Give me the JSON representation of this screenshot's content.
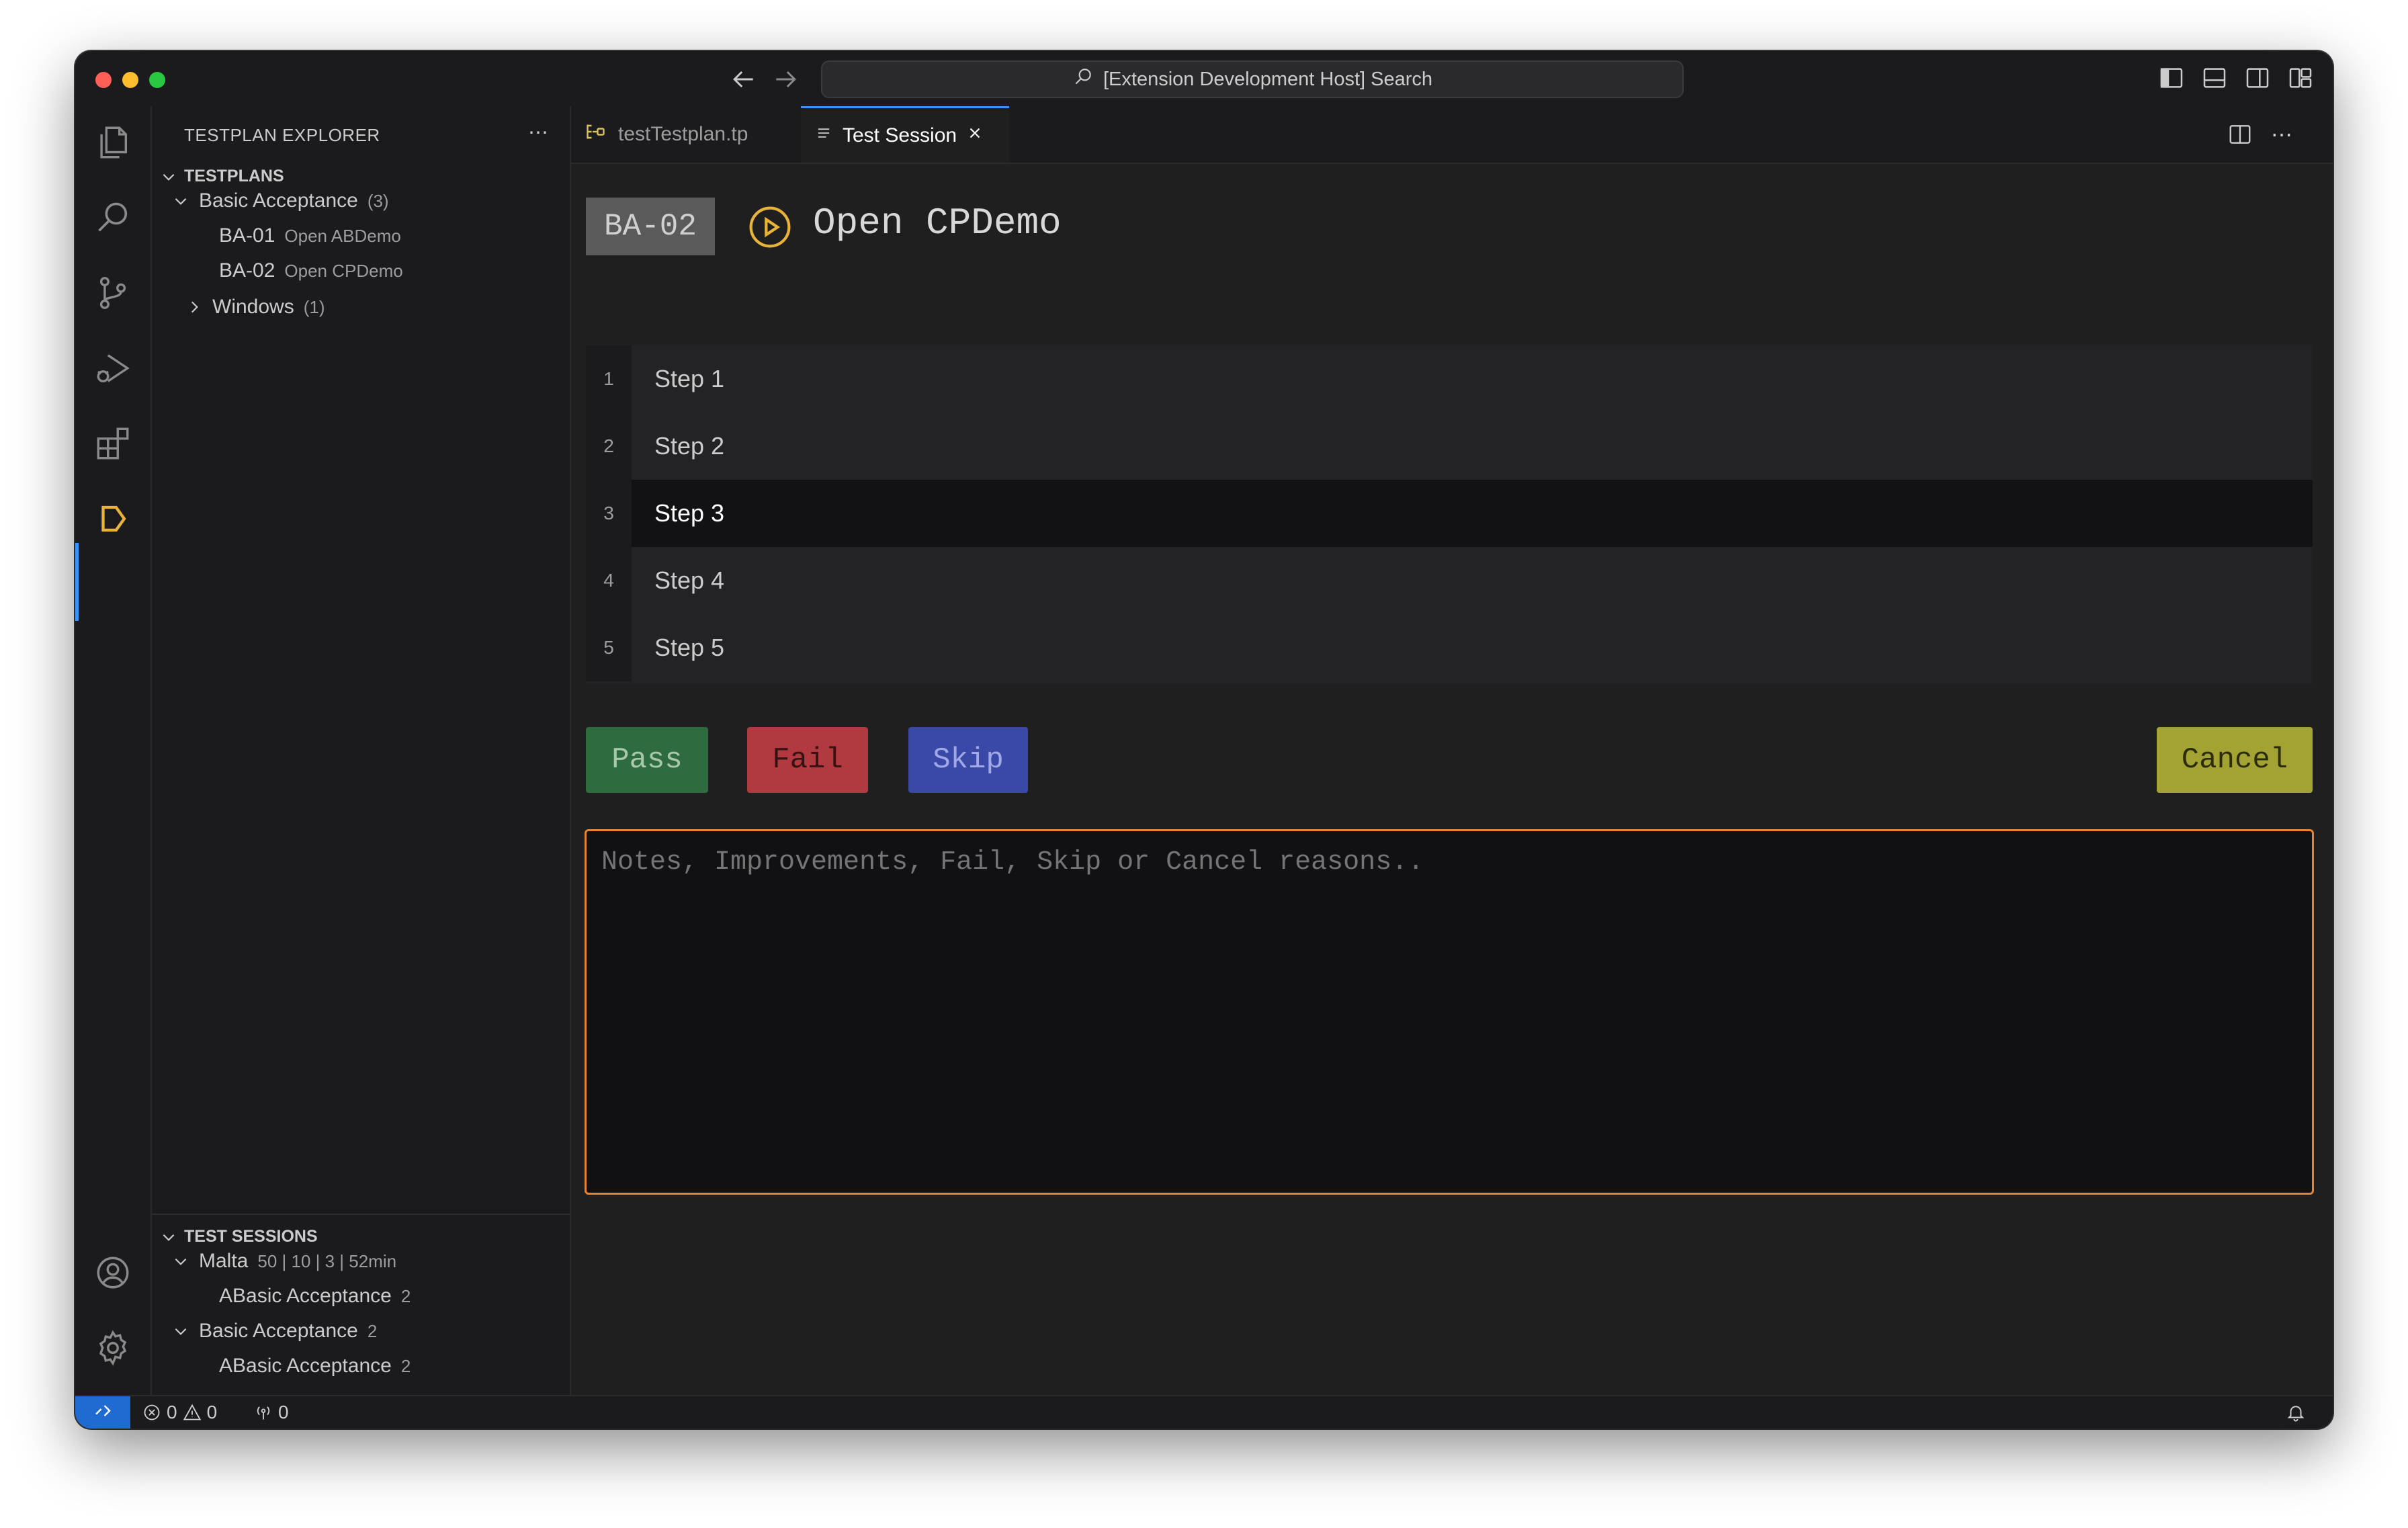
{
  "window": {
    "search_text": "[Extension Development Host] Search"
  },
  "sidebar": {
    "title": "TESTPLAN EXPLORER",
    "testplans": {
      "header": "TESTPLANS",
      "groups": [
        {
          "label": "Basic Acceptance",
          "count": "(3)",
          "items": [
            {
              "id": "BA-01",
              "desc": "Open ABDemo"
            },
            {
              "id": "BA-02",
              "desc": "Open CPDemo"
            }
          ]
        },
        {
          "label": "Windows",
          "count": "(1)"
        }
      ]
    },
    "sessions": {
      "header": "TEST SESSIONS",
      "groups": [
        {
          "label": "Malta",
          "meta": "50 | 10 | 3 | 52min",
          "child": {
            "label": "ABasic Acceptance",
            "count": "2"
          }
        },
        {
          "label": "Basic Acceptance",
          "meta": "2",
          "child": {
            "label": "ABasic Acceptance",
            "count": "2"
          }
        }
      ]
    }
  },
  "tabs": [
    {
      "label": "testTestplan.tp"
    },
    {
      "label": "Test Session"
    }
  ],
  "testcase": {
    "id": "BA-02",
    "title": "Open CPDemo",
    "steps": [
      {
        "num": "1",
        "label": "Step 1"
      },
      {
        "num": "2",
        "label": "Step 2"
      },
      {
        "num": "3",
        "label": "Step 3"
      },
      {
        "num": "4",
        "label": "Step 4"
      },
      {
        "num": "5",
        "label": "Step 5"
      }
    ],
    "selected_step": "3"
  },
  "actions": {
    "pass": "Pass",
    "fail": "Fail",
    "skip": "Skip",
    "cancel": "Cancel"
  },
  "notes": {
    "placeholder": "Notes, Improvements, Fail, Skip or Cancel reasons.."
  },
  "statusbar": {
    "errors": "0",
    "warnings": "0",
    "ports": "0"
  },
  "colors": {
    "accent": "#3794ff",
    "pass": "#2e6b3f",
    "fail": "#b03a3f",
    "skip": "#3a49a8",
    "cancel": "#a3a334",
    "notes_border": "#e78433",
    "play_icon": "#e8b338"
  }
}
